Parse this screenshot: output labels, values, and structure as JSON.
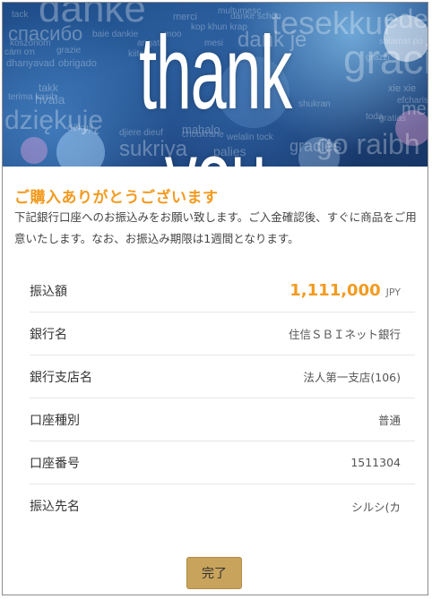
{
  "hero": {
    "title": "thank you",
    "background_words": [
      "danke",
      "tesekkur",
      "ederim",
      "gracias",
      "спасибо",
      "dank je",
      "dziękuję",
      "go raibh ma",
      "merci",
      "grazie",
      "arigato",
      "obrigado",
      "kiitos",
      "takk",
      "hvala",
      "mahalo",
      "sukriya",
      "dhanyavad",
      "shukran",
      "xie xie",
      "efcharisto",
      "toda",
      "terima kasih",
      "köszönöm",
      "tack",
      "děkuji",
      "grazzi",
      "multumesc",
      "gratias",
      "mersi",
      "djiere dieuf",
      "moo",
      "choukrane",
      "danke schön",
      "salamat po",
      "welalin tock",
      "palies",
      "gracies",
      "kop khun krap",
      "mesi",
      "baie dankie",
      "cám ơn"
    ]
  },
  "heading": "ご購入ありがとうございます",
  "intro": "下記銀行口座へのお振込みをお願い致します。ご入金確認後、すぐに商品をご用意いたします。なお、お振込み期限は1週間となります。",
  "details": {
    "amount_label": "振込額",
    "amount_value": "1,111,000",
    "amount_currency": "JPY",
    "bank_label": "銀行名",
    "bank_value": "住信ＳＢＩネット銀行",
    "branch_label": "銀行支店名",
    "branch_value": "法人第一支店(106)",
    "type_label": "口座種別",
    "type_value": "普通",
    "number_label": "口座番号",
    "number_value": "1511304",
    "payee_label": "振込先名",
    "payee_value": "シルシ(カ"
  },
  "button": {
    "label": "完了"
  },
  "colors": {
    "accent": "#f39a1f",
    "button_bg": "#c8a35b",
    "hero_blue": "#1e4c88"
  }
}
